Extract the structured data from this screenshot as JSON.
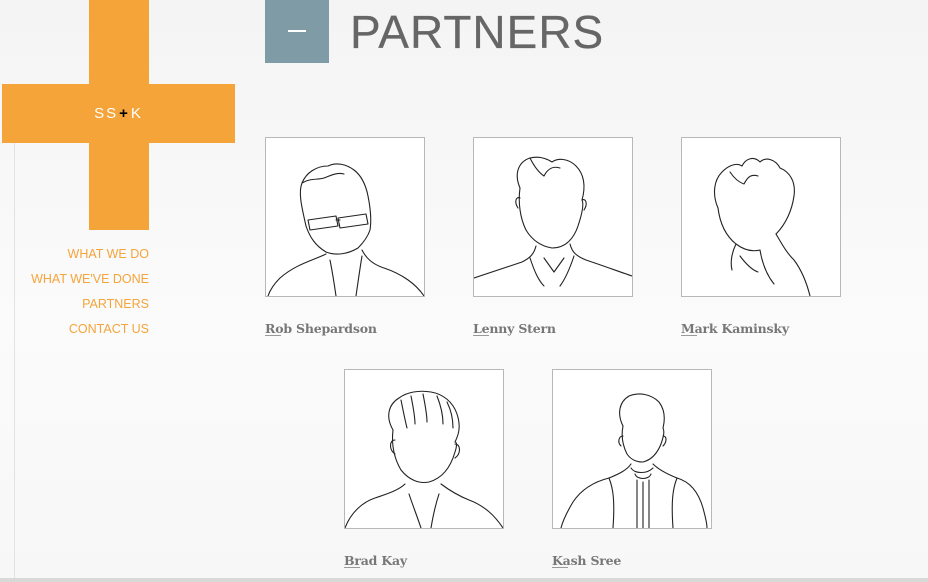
{
  "logo": {
    "left": "SS",
    "plus": "+",
    "right": "K"
  },
  "nav": {
    "items": [
      {
        "label": "WHAT WE DO"
      },
      {
        "label": "WHAT WE'VE DONE"
      },
      {
        "label": "PARTNERS"
      },
      {
        "label": "CONTACT US"
      }
    ]
  },
  "header": {
    "collapse_icon": "minus-icon",
    "title": "PARTNERS"
  },
  "partners": [
    {
      "name": "Rob Shepardson"
    },
    {
      "name": "Lenny Stern"
    },
    {
      "name": "Mark Kaminsky"
    },
    {
      "name": "Brad Kay"
    },
    {
      "name": "Kash Sree"
    }
  ],
  "colors": {
    "accent_orange": "#f5a43a",
    "header_box": "#7f9ba5",
    "title_gray": "#666666"
  }
}
